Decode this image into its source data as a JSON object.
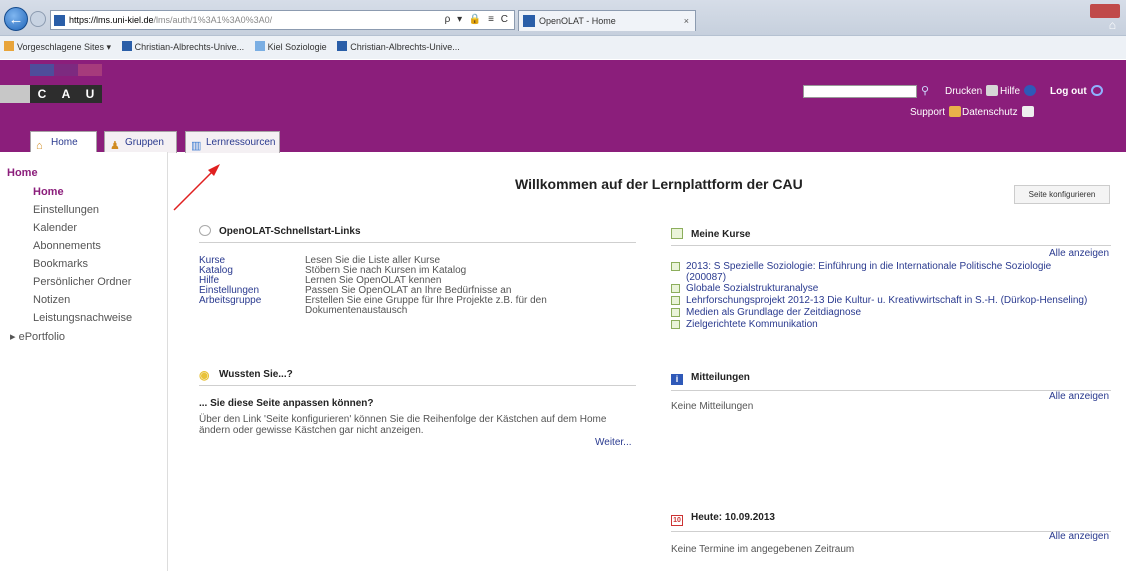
{
  "browser": {
    "url_host": "https://lms.uni-kiel.de",
    "url_path": "/lms/auth/1%3A1%3A0%3A0/",
    "addr_controls": "ρ ▾ 🔒 ≡ C",
    "tab_title": "OpenOLAT - Home",
    "bookmarks": [
      "Vorgeschlagene Sites ▾",
      "Christian-Albrechts-Unive...",
      "Kiel Soziologie",
      "Christian-Albrechts-Unive..."
    ]
  },
  "header": {
    "logo_letters": [
      "C",
      "A",
      "U"
    ],
    "print_label": "Drucken",
    "help_label": "Hilfe",
    "logout_label": "Log out",
    "support_label": "Support",
    "privacy_label": "Datenschutz",
    "colors": {
      "brand": "#8b1e7b"
    }
  },
  "tabs": [
    {
      "label": "Home"
    },
    {
      "label": "Gruppen"
    },
    {
      "label": "Lernressourcen"
    }
  ],
  "sidebar": {
    "heading": "Home",
    "items": [
      "Home",
      "Einstellungen",
      "Kalender",
      "Abonnements",
      "Bookmarks",
      "Persönlicher Ordner",
      "Notizen",
      "Leistungsnachweise",
      "▸ ePortfolio"
    ]
  },
  "main": {
    "title": "Willkommen auf der Lernplattform der CAU",
    "config_button": "Seite konfigurieren",
    "quicklinks": {
      "title": "OpenOLAT-Schnellstart-Links",
      "rows": [
        {
          "link": "Kurse",
          "desc": "Lesen Sie die Liste aller Kurse"
        },
        {
          "link": "Katalog",
          "desc": "Stöbern Sie nach Kursen im Katalog"
        },
        {
          "link": "Hilfe",
          "desc": "Lernen Sie OpenOLAT kennen"
        },
        {
          "link": "Einstellungen",
          "desc": "Passen Sie OpenOLAT an Ihre Bedürfnisse an"
        },
        {
          "link": "Arbeitsgruppe",
          "desc": "Erstellen Sie eine Gruppe für Ihre Projekte z.B. für den"
        }
      ],
      "desc_continuation": "Dokumentenaustausch"
    },
    "didyouknow": {
      "title": "Wussten Sie...?",
      "subtitle": "... Sie diese Seite anpassen können?",
      "text1": "Über den Link 'Seite konfigurieren' können Sie die Reihenfolge der Kästchen auf dem Home",
      "text2": "ändern oder gewisse Kästchen gar nicht anzeigen.",
      "more": "Weiter..."
    },
    "courses": {
      "title": "Meine Kurse",
      "all": "Alle anzeigen",
      "items": [
        "2013: S Spezielle Soziologie: Einführung in die Internationale Politische Soziologie",
        "Globale Sozialstrukturanalyse",
        "Lehrforschungsprojekt 2012-13 Die Kultur- u. Kreativwirtschaft in S.-H. (Dürkop-Henseling)",
        "Medien als Grundlage der Zeitdiagnose",
        "Zielgerichtete Kommunikation"
      ],
      "first_continuation": "(200087)"
    },
    "news": {
      "title": "Mitteilungen",
      "all": "Alle anzeigen",
      "empty": "Keine Mitteilungen"
    },
    "today": {
      "title": "Heute: 10.09.2013",
      "all": "Alle anzeigen",
      "empty": "Keine Termine im angegebenen Zeitraum"
    }
  }
}
